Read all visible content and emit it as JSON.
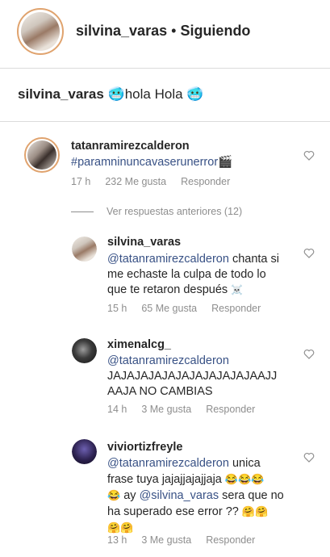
{
  "header": {
    "username": "silvina_varas",
    "separator": "•",
    "follow_status": "Siguiendo"
  },
  "caption": {
    "username": "silvina_varas",
    "emoji_left": "🥶",
    "text": "hola Hola",
    "emoji_right": "🥶"
  },
  "comments": [
    {
      "username": "tatanramirezcalderon",
      "text": "#paramninuncavaserunerror",
      "emoji": "🎬",
      "time": "17 h",
      "likes": "232 Me gusta",
      "reply": "Responder"
    }
  ],
  "view_replies": "Ver respuestas anteriores (12)",
  "replies": [
    {
      "username": "silvina_varas",
      "mention": "@tatanramirezcalderon",
      "line1": " chanta si",
      "line2": "me echaste la culpa de todo lo",
      "line3": "que te retaron después",
      "emoji": "☠️",
      "time": "15 h",
      "likes": "65 Me gusta",
      "reply": "Responder"
    },
    {
      "username": "ximenalcg_",
      "mention": "@tatanramirezcalderon",
      "line2": "JAJAJAJAJAJAJAJAJAJAJAAJJ",
      "line3": "AAJA NO CAMBIAS",
      "time": "14 h",
      "likes": "3 Me gusta",
      "reply": "Responder"
    },
    {
      "username": "viviortizfreyle",
      "mention": "@tatanramirezcalderon",
      "line1": " unica",
      "line2": "frase tuya jajajjajajjaja",
      "line2_emoji": "😂😂😂",
      "line3_emoji": "😂",
      "line3": " ay ",
      "mention2": "@silvina_varas",
      "line3_end": " sera que no",
      "line4": "ha superado ese  error ??",
      "line4_emoji": "🤗🤗",
      "line5_emoji": "🤗🤗",
      "time": "13 h",
      "likes": "3 Me gusta",
      "reply": "Responder"
    }
  ]
}
